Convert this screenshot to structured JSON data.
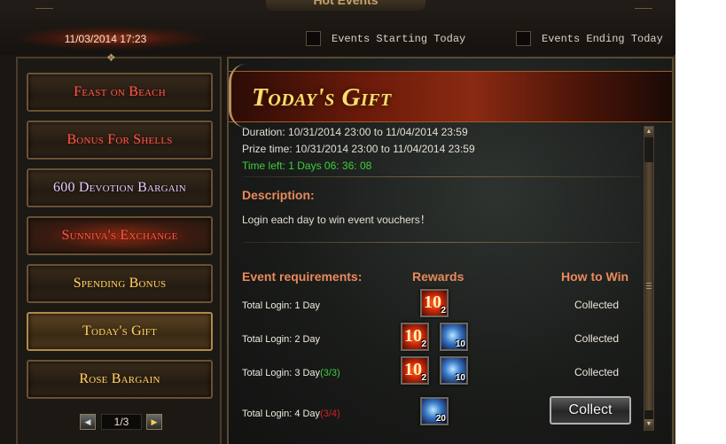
{
  "window": {
    "title": "Hot Events"
  },
  "topbar": {
    "datetime": "11/03/2014 17:23",
    "events_starting_label": "Events Starting Today",
    "events_ending_label": "Events Ending Today"
  },
  "sidebar": {
    "items": [
      {
        "label": "Feast on Beach",
        "color": "#ff5a4a"
      },
      {
        "label": "Bonus For Shells",
        "color": "#ff5a4a"
      },
      {
        "label": "600 Devotion Bargain",
        "color": "#e8ccff"
      },
      {
        "label": "Sunniva's Exchange",
        "color": "#ff5a4a"
      },
      {
        "label": "Spending Bonus",
        "color": "#ffd56a"
      },
      {
        "label": "Today's Gift",
        "color": "#ffd56a",
        "selected": true
      },
      {
        "label": "Rose Bargain",
        "color": "#ffd56a"
      }
    ],
    "pager": {
      "text": "1/3",
      "prev_icon": "arrow-left",
      "next_icon": "arrow-right"
    }
  },
  "event": {
    "title": "Today's Gift",
    "duration": "Duration: 10/31/2014 23:00 to 11/04/2014 23:59",
    "prize_time": "Prize time: 10/31/2014 23:00 to 11/04/2014 23:59",
    "time_left": "Time left: 1 Days  06: 36: 08",
    "description_title": "Description:",
    "description": "Login each day to win event vouchers！",
    "headers": {
      "requirements": "Event requirements:",
      "rewards": "Rewards",
      "how_to_win": "How to Win"
    },
    "rows": [
      {
        "label": "Total Login: 1 Day",
        "progress": "",
        "status": "Collected",
        "rewards": [
          {
            "icon": "voucher-icon",
            "big": "10",
            "count": "2"
          }
        ]
      },
      {
        "label": "Total Login: 2 Day",
        "progress": "",
        "status": "Collected",
        "rewards": [
          {
            "icon": "voucher-icon",
            "big": "10",
            "count": "2"
          },
          {
            "icon": "orb-icon",
            "count": "10"
          }
        ]
      },
      {
        "label": "Total Login: 3 Day",
        "progress": "(3/3)",
        "status": "Collected",
        "rewards": [
          {
            "icon": "voucher-icon",
            "big": "10",
            "count": "2"
          },
          {
            "icon": "orb-icon",
            "count": "10"
          }
        ]
      },
      {
        "label": "Total Login: 4 Day",
        "progress": "(3/4)",
        "status": "",
        "rewards": [
          {
            "icon": "orb-icon",
            "count": "20"
          }
        ]
      }
    ],
    "collect_button": "Collect"
  }
}
